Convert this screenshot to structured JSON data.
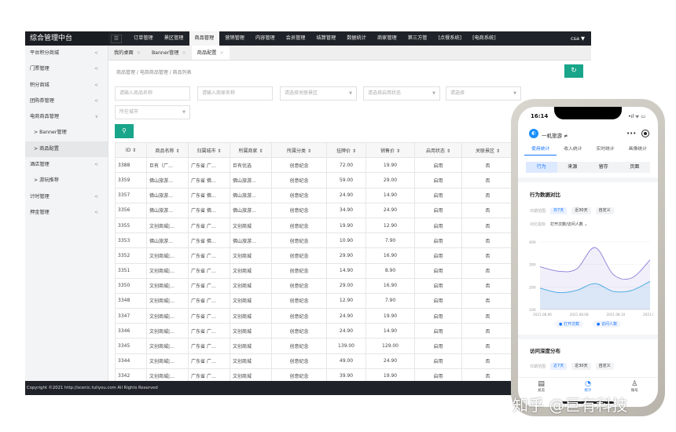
{
  "app": {
    "brand": "综合管理中台",
    "menu_icon": "☰",
    "nav": [
      "订单管理",
      "景区管理",
      "商品管理",
      "营销管理",
      "内容管理",
      "会员管理",
      "结算管理",
      "数据统计",
      "商家管理",
      "第三方管",
      "[点餐系统]",
      "[电商系统]"
    ],
    "user": "csa ▼"
  },
  "sidebar": {
    "items": [
      {
        "label": "平台积分商城",
        "chev": "<"
      },
      {
        "label": "门票管理",
        "chev": "<"
      },
      {
        "label": "积分商城",
        "chev": "<"
      },
      {
        "label": "团购券管理",
        "chev": "<"
      },
      {
        "label": "电商商品管理",
        "chev": "∨"
      },
      {
        "label": ">  Banner管理",
        "chev": ""
      },
      {
        "label": ">  商品配置",
        "chev": ""
      },
      {
        "label": "酒店管理",
        "chev": "<"
      },
      {
        "label": ">  游玩推荐",
        "chev": ""
      },
      {
        "label": "计时管理",
        "chev": "<"
      },
      {
        "label": "押金管理",
        "chev": "<"
      }
    ]
  },
  "tabs": [
    {
      "label": "我的桌面",
      "close": "×"
    },
    {
      "label": "Banner管理",
      "close": "×"
    },
    {
      "label": "商品配置",
      "close": "×"
    }
  ],
  "breadcrumb": "商品管理 / 电商商品管理 / 商品列表",
  "refresh_icon": "↻",
  "filters": {
    "product_name": "请输入商品名称",
    "merchant_name": "请输入商家名称",
    "scenic": "请选择关联景区",
    "status": "请选择启用状态",
    "select": "请选择",
    "city": "所在城市"
  },
  "search_icon": "⚲",
  "table": {
    "headers": [
      "ID ⇕",
      "商品名称 ⇕",
      "归属城市 ⇕",
      "所属商家 ⇕",
      "所属分类 ⇕",
      "挂牌价 ⇕",
      "销售价 ⇕",
      "启用状态 ⇕",
      "关联景区 ⇕"
    ],
    "rows": [
      [
        "3388",
        "巨有（广…",
        "广东省 广…",
        "巨有优选",
        "创意纪念",
        "72.00",
        "19.90",
        "启用",
        "否"
      ],
      [
        "3359",
        "佛山旅游…",
        "广东省 佛…",
        "佛山旅游…",
        "创意纪念",
        "59.00",
        "29.00",
        "启用",
        "否"
      ],
      [
        "3357",
        "佛山旅游…",
        "广东省 佛…",
        "佛山旅游…",
        "创意纪念",
        "24.90",
        "14.90",
        "启用",
        "否"
      ],
      [
        "3356",
        "佛山旅游…",
        "广东省 佛…",
        "佛山旅游…",
        "创意纪念",
        "34.90",
        "24.90",
        "启用",
        "否"
      ],
      [
        "3355",
        "文创商城|…",
        "广东省 广…",
        "文创商城",
        "创意纪念",
        "19.90",
        "12.90",
        "启用",
        "否"
      ],
      [
        "3353",
        "佛山旅游…",
        "广东省 佛…",
        "佛山旅游…",
        "创意纪念",
        "10.90",
        "7.90",
        "启用",
        "否"
      ],
      [
        "3352",
        "文创商城|…",
        "广东省 广…",
        "文创商城",
        "创意纪念",
        "29.90",
        "16.90",
        "启用",
        "否"
      ],
      [
        "3351",
        "文创商城|…",
        "广东省 广…",
        "文创商城",
        "创意纪念",
        "14.90",
        "8.90",
        "启用",
        "否"
      ],
      [
        "3350",
        "文创商城|…",
        "广东省 广…",
        "文创商城",
        "创意纪念",
        "29.00",
        "16.90",
        "启用",
        "否"
      ],
      [
        "3348",
        "文创商城|…",
        "广东省 广…",
        "文创商城",
        "创意纪念",
        "12.90",
        "7.90",
        "启用",
        "否"
      ],
      [
        "3347",
        "文创商城|…",
        "广东省 广…",
        "文创商城",
        "创意纪念",
        "24.90",
        "19.90",
        "启用",
        "否"
      ],
      [
        "3346",
        "文创商城|…",
        "广东省 广…",
        "文创商城",
        "创意纪念",
        "24.90",
        "14.90",
        "启用",
        "否"
      ],
      [
        "3345",
        "文创商城|…",
        "广东省 广…",
        "文创商城",
        "创意纪念",
        "139.00",
        "129.00",
        "启用",
        "否"
      ],
      [
        "3344",
        "文创商城|…",
        "广东省 广…",
        "文创商城",
        "创意纪念",
        "49.00",
        "24.90",
        "启用",
        "否"
      ],
      [
        "3342",
        "文创商城|…",
        "广东省 广…",
        "文创商城",
        "创意纪念",
        "39.90",
        "19.90",
        "启用",
        "否"
      ]
    ]
  },
  "footer": "Copyright ©2021 http://scenic.tuliyou.com All Rights Reserved",
  "phone": {
    "time": "16:14",
    "signal": "•ıl ᯤ ▭",
    "app_name": "一机旅游 ≠",
    "more": "•••",
    "tabs": [
      "使用统计",
      "收入统计",
      "实时统计",
      "画像统计"
    ],
    "segments": [
      "行为",
      "来源",
      "留存",
      "页面"
    ],
    "section1": "行为数据对比",
    "date_label": "日期范围",
    "date_chips": [
      "日7天",
      "近30天",
      "自定义"
    ],
    "indicator_label": "对比指标",
    "indicator_value": "打开次数/访问人数 ⌄",
    "chart_y": [
      "400",
      "300",
      "200",
      "100"
    ],
    "chart_x": [
      "2021.08.06",
      "2021.08.08",
      "2021.08.10",
      "2021.08."
    ],
    "legend": [
      "● 打开次数",
      "● 访问人数"
    ],
    "section2": "访问深度分布",
    "date_label2": "日期范围",
    "date_chips2": [
      "近7天",
      "近30天",
      "自定义"
    ],
    "bottom": [
      {
        "icon": "▤",
        "label": "总览"
      },
      {
        "icon": "◔",
        "label": "统计"
      },
      {
        "icon": "♙",
        "label": "账号"
      }
    ]
  },
  "watermark": "知乎 @巨有科技",
  "chart_data": {
    "type": "area",
    "x": [
      "2021.08.06",
      "2021.08.07",
      "2021.08.08",
      "2021.08.09",
      "2021.08.10",
      "2021.08.11",
      "2021.08.12"
    ],
    "series": [
      {
        "name": "打开次数",
        "values": [
          290,
          270,
          280,
          375,
          255,
          240,
          320
        ]
      },
      {
        "name": "访问人数",
        "values": [
          195,
          175,
          185,
          215,
          180,
          185,
          225
        ]
      }
    ],
    "ylim": [
      100,
      400
    ],
    "colors": {
      "打开次数": "#8a7fd6",
      "访问人数": "#3fa7e0"
    }
  }
}
